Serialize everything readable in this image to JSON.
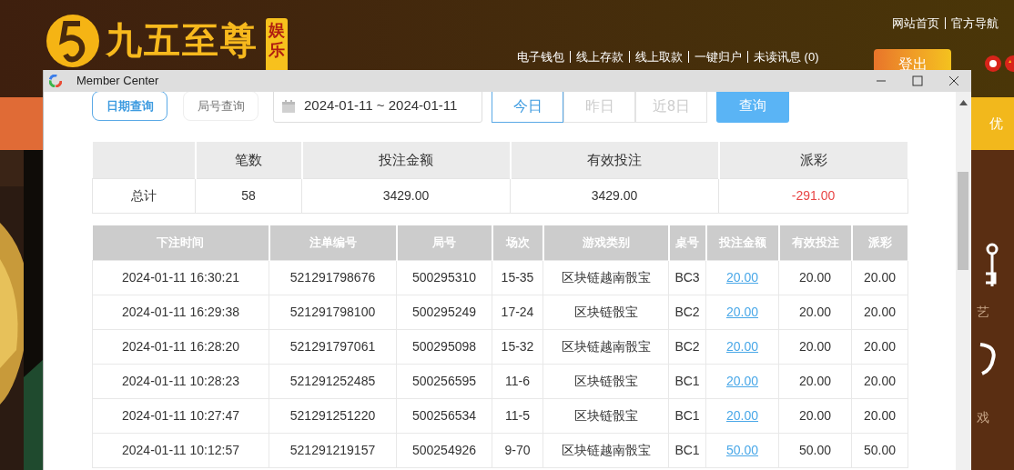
{
  "site": {
    "logo_text": "九五至尊",
    "logo_badge": "娱乐",
    "top_links": [
      "网站首页",
      "官方导航"
    ],
    "nav_links": [
      "电子钱包",
      "线上存款",
      "线上取款",
      "一键归户",
      "未读讯息 (0)"
    ],
    "logout_button": "登出",
    "promo_tab": "优",
    "side_labels": [
      "艺",
      "戏"
    ]
  },
  "window": {
    "title": "Member Center",
    "query_tabs": [
      {
        "label": "日期查询",
        "selected": true
      },
      {
        "label": "局号查询",
        "selected": false
      }
    ],
    "date_range": "2024-01-11 ~ 2024-01-11",
    "quick_ranges": [
      {
        "label": "今日",
        "selected": true
      },
      {
        "label": "昨日",
        "selected": false
      },
      {
        "label": "近8日",
        "selected": false
      }
    ],
    "search_button": "查询",
    "summary": {
      "columns": [
        "笔数",
        "投注金额",
        "有效投注",
        "派彩"
      ],
      "label": "总计",
      "count": "58",
      "stake": "3429.00",
      "valid": "3429.00",
      "payout": "-291.00",
      "payout_negative": true
    },
    "bets": {
      "columns": [
        "下注时间",
        "注单编号",
        "局号",
        "场次",
        "游戏类别",
        "桌号",
        "投注金额",
        "有效投注",
        "派彩"
      ],
      "rows": [
        {
          "time": "2024-01-11 16:30:21",
          "order_no": "521291798676",
          "round": "500295310",
          "session": "15-35",
          "game": "区块链越南骰宝",
          "table": "BC3",
          "stake": "20.00",
          "valid": "20.00",
          "payout": "20.00"
        },
        {
          "time": "2024-01-11 16:29:38",
          "order_no": "521291798100",
          "round": "500295249",
          "session": "17-24",
          "game": "区块链骰宝",
          "table": "BC2",
          "stake": "20.00",
          "valid": "20.00",
          "payout": "20.00"
        },
        {
          "time": "2024-01-11 16:28:20",
          "order_no": "521291797061",
          "round": "500295098",
          "session": "15-32",
          "game": "区块链越南骰宝",
          "table": "BC2",
          "stake": "20.00",
          "valid": "20.00",
          "payout": "20.00"
        },
        {
          "time": "2024-01-11 10:28:23",
          "order_no": "521291252485",
          "round": "500256595",
          "session": "11-6",
          "game": "区块链骰宝",
          "table": "BC1",
          "stake": "20.00",
          "valid": "20.00",
          "payout": "20.00"
        },
        {
          "time": "2024-01-11 10:27:47",
          "order_no": "521291251220",
          "round": "500256534",
          "session": "11-5",
          "game": "区块链骰宝",
          "table": "BC1",
          "stake": "20.00",
          "valid": "20.00",
          "payout": "20.00"
        },
        {
          "time": "2024-01-11 10:12:57",
          "order_no": "521291219157",
          "round": "500254926",
          "session": "9-70",
          "game": "区块链越南骰宝",
          "table": "BC1",
          "stake": "50.00",
          "valid": "50.00",
          "payout": "50.00"
        }
      ]
    }
  }
}
